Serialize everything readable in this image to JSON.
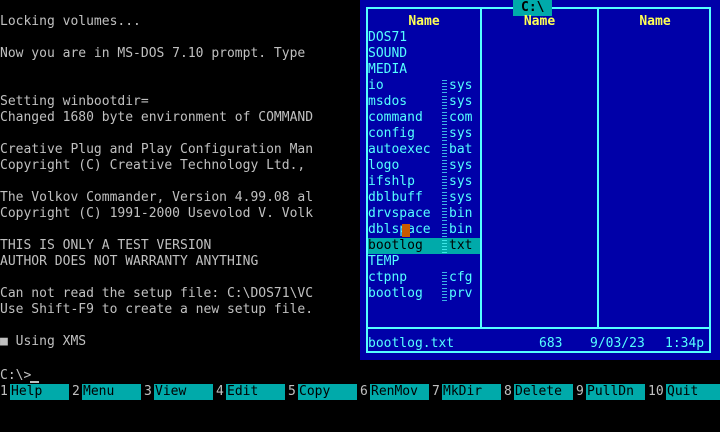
{
  "terminal": {
    "lines": [
      "Locking volumes...",
      "",
      "Now you are in MS-DOS 7.10 prompt. Type",
      "",
      "",
      "Setting winbootdir=",
      "Changed 1680 byte environment of COMMAND",
      "",
      "Creative Plug and Play Configuration Man",
      "Copyright (C) Creative Technology Ltd.,",
      "",
      "The Volkov Commander, Version 4.99.08 al",
      "Copyright (C) 1991-2000 Usevolod V. Volk",
      "",
      "THIS IS ONLY A TEST VERSION",
      "AUTHOR DOES NOT WARRANTY ANYTHING",
      "",
      "Can not read the setup file: C:\\DOS71\\VC",
      "Use Shift-F9 to create a new setup file.",
      "",
      "■ Using XMS"
    ],
    "prompt": "C:\\>"
  },
  "panel": {
    "path": "C:\\",
    "column_headers": [
      "Name",
      "Name",
      "Name"
    ],
    "files": [
      {
        "name": "DOS71",
        "ext": "",
        "dir": true
      },
      {
        "name": "SOUND",
        "ext": "",
        "dir": true
      },
      {
        "name": "MEDIA",
        "ext": "",
        "dir": true
      },
      {
        "name": "io",
        "ext": "sys",
        "dir": false
      },
      {
        "name": "msdos",
        "ext": "sys",
        "dir": false
      },
      {
        "name": "command",
        "ext": "com",
        "dir": false
      },
      {
        "name": "config",
        "ext": "sys",
        "dir": false
      },
      {
        "name": "autoexec",
        "ext": "bat",
        "dir": false
      },
      {
        "name": "logo",
        "ext": "sys",
        "dir": false
      },
      {
        "name": "ifshlp",
        "ext": "sys",
        "dir": false
      },
      {
        "name": "dblbuff",
        "ext": "sys",
        "dir": false
      },
      {
        "name": "drvspace",
        "ext": "bin",
        "dir": false
      },
      {
        "name": "dblspace",
        "ext": "bin",
        "dir": false
      },
      {
        "name": "bootlog",
        "ext": "txt",
        "dir": false,
        "selected": true
      },
      {
        "name": "TEMP",
        "ext": "",
        "dir": true
      },
      {
        "name": "ctpnp",
        "ext": "cfg",
        "dir": false
      },
      {
        "name": "bootlog",
        "ext": "prv",
        "dir": false
      }
    ],
    "status": {
      "filename": "bootlog.txt",
      "size": "683",
      "date": "9/03/23",
      "time": "1:34p"
    }
  },
  "function_keys": [
    {
      "num": "1",
      "label": "Help"
    },
    {
      "num": "2",
      "label": "Menu"
    },
    {
      "num": "3",
      "label": "View"
    },
    {
      "num": "4",
      "label": "Edit"
    },
    {
      "num": "5",
      "label": "Copy"
    },
    {
      "num": "6",
      "label": "RenMov"
    },
    {
      "num": "7",
      "label": "MkDir"
    },
    {
      "num": "8",
      "label": "Delete"
    },
    {
      "num": "9",
      "label": "PullDn"
    },
    {
      "num": "10",
      "label": "Quit"
    }
  ],
  "colors": {
    "panel_bg": "#0000a8",
    "panel_border": "#55ffff",
    "header_text": "#ffff55",
    "selection_bg": "#00aaaa",
    "terminal_text": "#c0c0c0"
  }
}
